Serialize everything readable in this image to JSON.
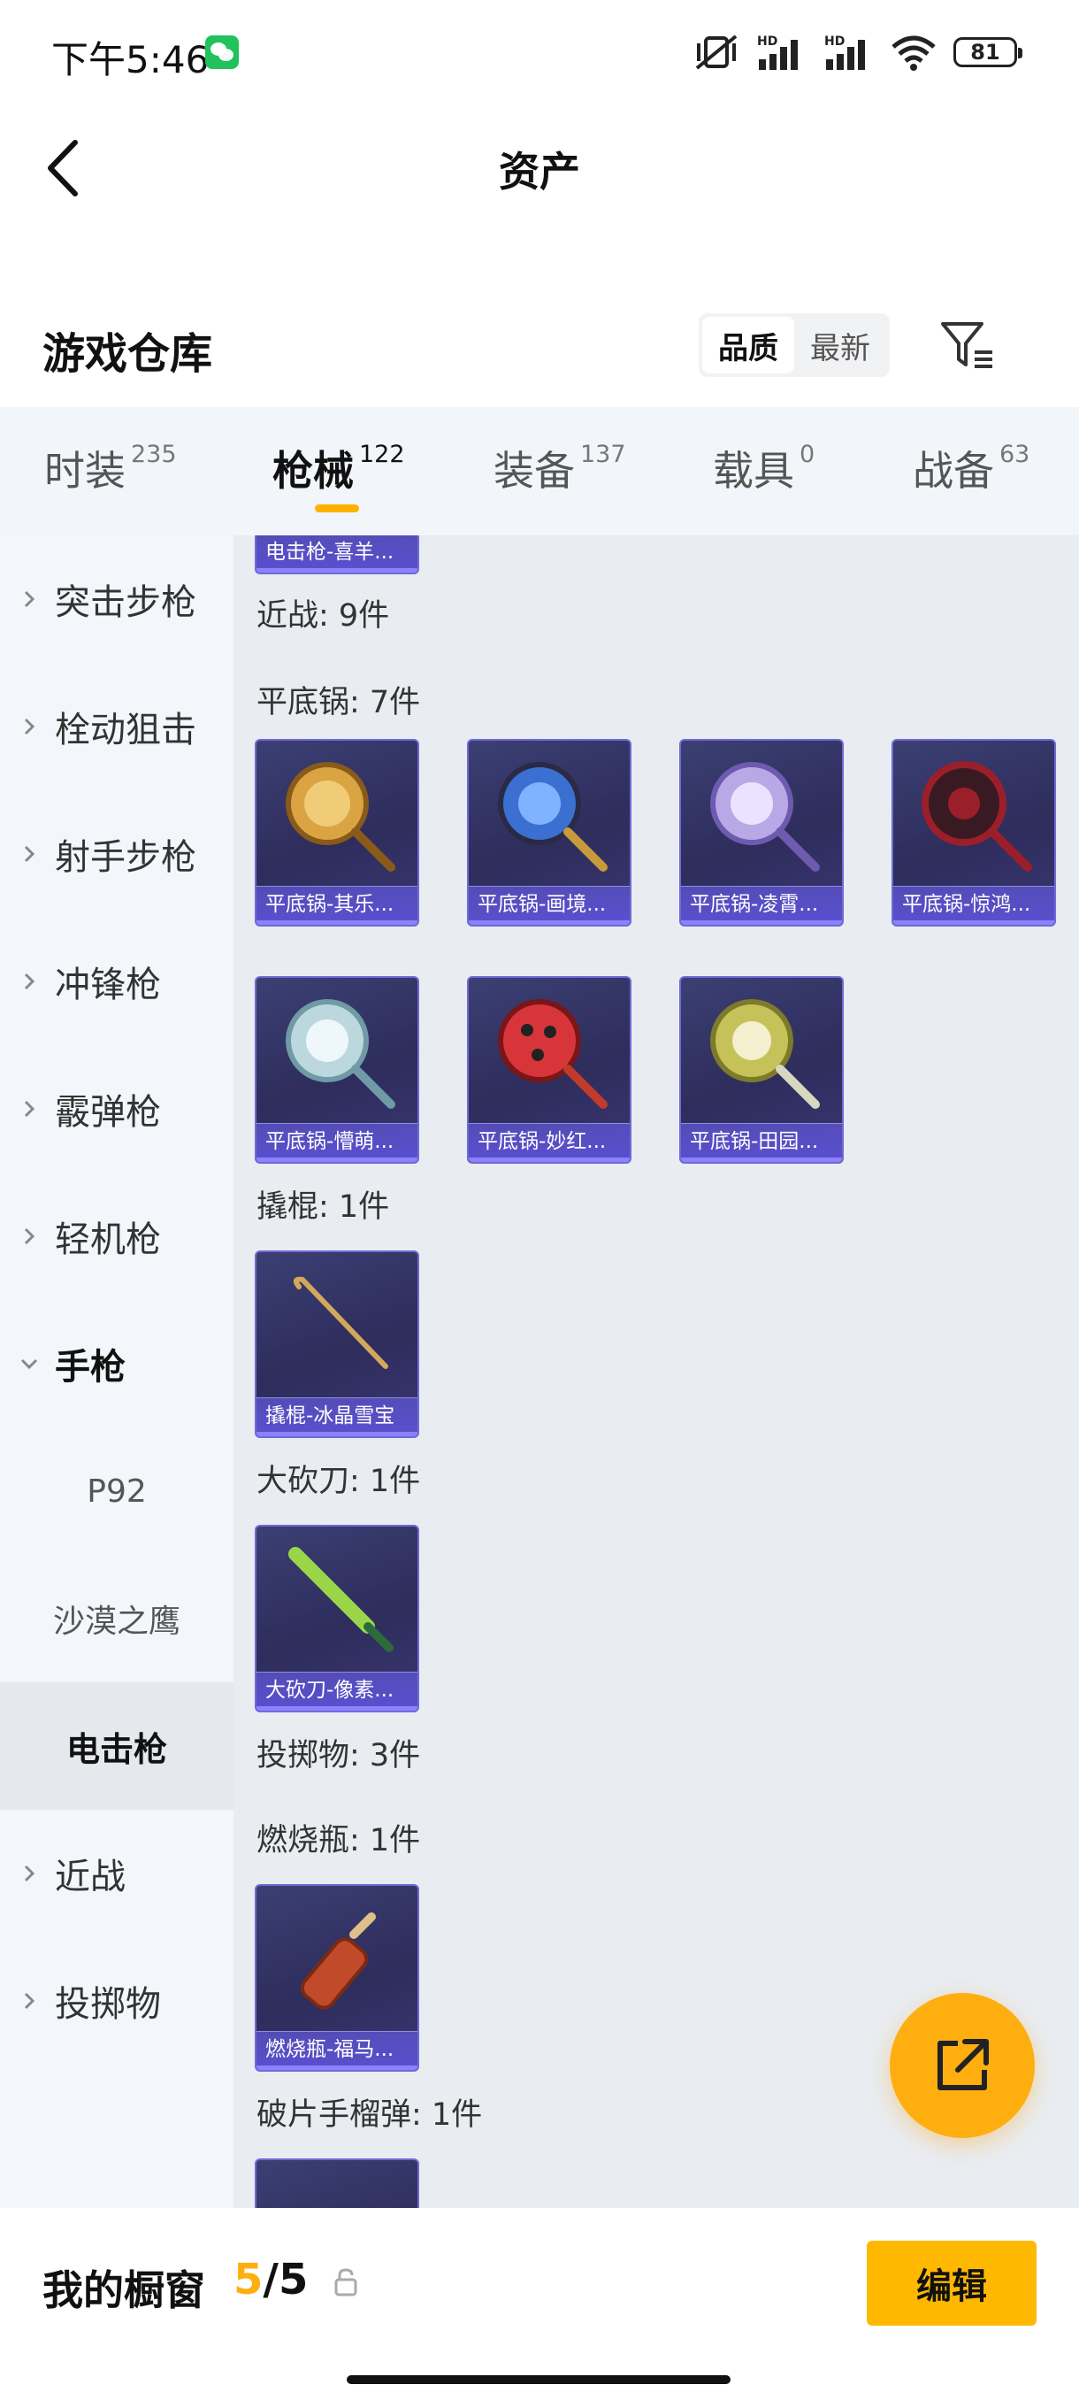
{
  "status_bar": {
    "time": "下午5:46",
    "battery": "81",
    "network_labels": [
      "HD",
      "HD"
    ]
  },
  "header": {
    "title": "资产"
  },
  "warehouse": {
    "title": "游戏仓库",
    "sort_options": [
      "品质",
      "最新"
    ],
    "active_sort": "品质"
  },
  "tabs": [
    {
      "label": "时装",
      "count": "235"
    },
    {
      "label": "枪械",
      "count": "122",
      "active": true
    },
    {
      "label": "装备",
      "count": "137"
    },
    {
      "label": "载具",
      "count": "0"
    },
    {
      "label": "战备",
      "count": "63"
    }
  ],
  "sidebar": {
    "items": [
      {
        "label": "突击步枪"
      },
      {
        "label": "栓动狙击"
      },
      {
        "label": "射手步枪"
      },
      {
        "label": "冲锋枪"
      },
      {
        "label": "霰弹枪"
      },
      {
        "label": "轻机枪"
      },
      {
        "label": "手枪"
      },
      {
        "label": "P92"
      },
      {
        "label": "沙漠之鹰"
      },
      {
        "label": "电击枪"
      },
      {
        "label": "近战"
      },
      {
        "label": "投掷物"
      }
    ]
  },
  "content": {
    "top_card_caption": "电击枪-喜羊...",
    "sections": [
      {
        "title": "近战: 9件"
      },
      {
        "title": "平底锅: 7件"
      },
      {
        "title": "撬棍: 1件"
      },
      {
        "title": "大砍刀: 1件"
      },
      {
        "title": "投掷物: 3件"
      },
      {
        "title": "燃烧瓶: 1件"
      },
      {
        "title": "破片手榴弹: 1件"
      }
    ],
    "cards": [
      {
        "caption": "平底锅-其乐...",
        "color": "#d9a441"
      },
      {
        "caption": "平底锅-画境...",
        "color": "#3b6fd1"
      },
      {
        "caption": "平底锅-凌霄...",
        "color": "#b9a8e6"
      },
      {
        "caption": "平底锅-惊鸿...",
        "color": "#9b1f2a"
      },
      {
        "caption": "平底锅-懵萌...",
        "color": "#bcd7de"
      },
      {
        "caption": "平底锅-妙红...",
        "color": "#d8353a"
      },
      {
        "caption": "平底锅-田园...",
        "color": "#c6c25a"
      },
      {
        "caption": "撬棍-冰晶雪宝",
        "color": "#d2a85a"
      },
      {
        "caption": "大砍刀-像素...",
        "color": "#9bd64a"
      },
      {
        "caption": "燃烧瓶-福马...",
        "color": "#c14a2a"
      }
    ]
  },
  "bottom_bar": {
    "title": "我的橱窗",
    "current": "5",
    "separator": "/",
    "max": "5",
    "edit_label": "编辑"
  }
}
